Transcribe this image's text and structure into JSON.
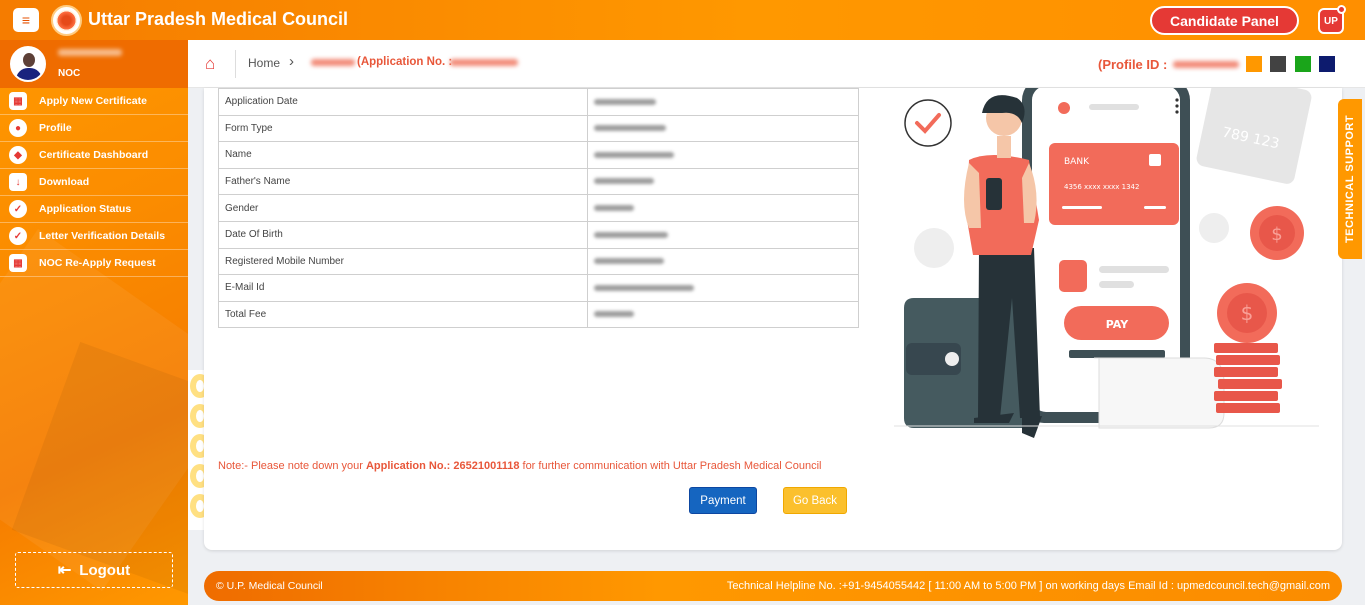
{
  "header": {
    "title": "Uttar Pradesh Medical Council",
    "candidate_panel": "Candidate Panel",
    "user_badge": "UP"
  },
  "sidebar": {
    "role": "NOC",
    "items": [
      {
        "label": "Apply New Certificate",
        "icon": "grid-icon"
      },
      {
        "label": "Profile",
        "icon": "user-icon"
      },
      {
        "label": "Certificate Dashboard",
        "icon": "shield-icon"
      },
      {
        "label": "Download",
        "icon": "download-file-icon"
      },
      {
        "label": "Application Status",
        "icon": "check-circle-icon"
      },
      {
        "label": "Letter Verification Details",
        "icon": "check-circle-icon"
      },
      {
        "label": "NOC Re-Apply Request",
        "icon": "grid-icon"
      }
    ],
    "logout": "Logout"
  },
  "breadcrumb": {
    "home": "Home",
    "application_label": "(Application No. :",
    "profile_id_label": "(Profile ID :"
  },
  "theme_swatches": [
    "#ff9800",
    "#424242",
    "#1aa51a",
    "#0d1b6e"
  ],
  "details": {
    "rows": [
      {
        "label": "Application Date"
      },
      {
        "label": "Form Type"
      },
      {
        "label": "Name"
      },
      {
        "label": "Father's Name"
      },
      {
        "label": "Gender"
      },
      {
        "label": "Date Of Birth"
      },
      {
        "label": "Registered Mobile Number"
      },
      {
        "label": "E-Mail Id"
      },
      {
        "label": "Total Fee"
      }
    ]
  },
  "note": {
    "prefix": "Note:- Please note down your ",
    "application_no": "Application No.: 26521001118",
    "suffix": " for further communication with Uttar Pradesh Medical Council"
  },
  "actions": {
    "payment": "Payment",
    "go_back": "Go Back"
  },
  "illustration": {
    "bank": "BANK",
    "card_number": "4356  xxxx  xxxx  1342",
    "pay": "PAY",
    "card_back_digits": "789 123",
    "currency_symbol": "$"
  },
  "tech_support": "TECHNICAL SUPPORT",
  "footer": {
    "copyright": "© U.P. Medical Council",
    "helpline": "Technical Helpline No. :+91-9454055442 [ 11:00 AM to 5:00 PM ] on working days  Email Id : upmedcouncil.tech@gmail.com"
  }
}
